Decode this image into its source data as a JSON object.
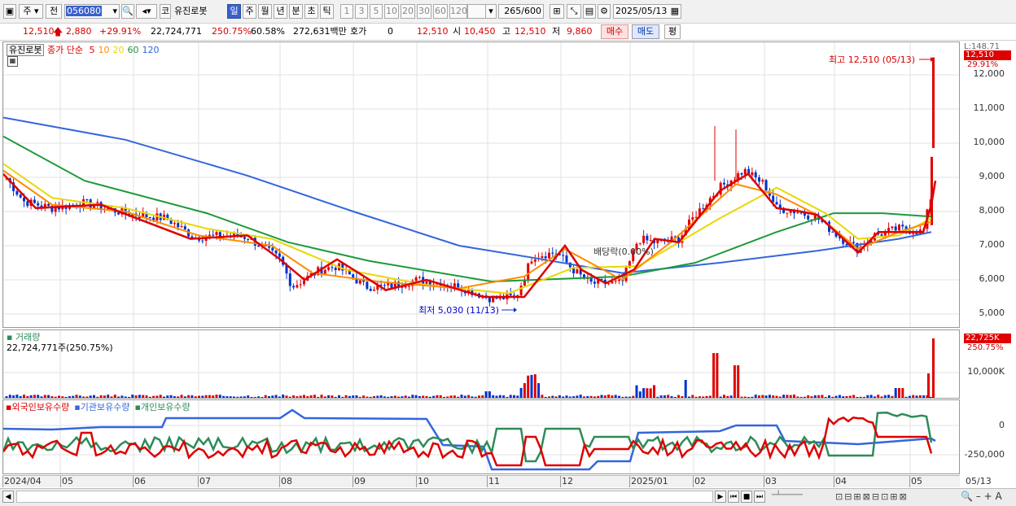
{
  "toolbar": {
    "period_type": "주",
    "prev": "전",
    "code": "056080",
    "market": "코",
    "name": "유진로봇",
    "periods": [
      "일",
      "주",
      "월",
      "년",
      "분",
      "초",
      "틱"
    ],
    "minutes": [
      "1",
      "3",
      "5",
      "10",
      "20",
      "30",
      "60",
      "120"
    ],
    "count": "265/600",
    "date": "2025/05/13"
  },
  "quote": {
    "price": "12,510",
    "change": "2,880",
    "change_pct": "+29.91%",
    "volume": "22,724,771",
    "volume_pct": "250.75%",
    "turnover_pct": "60.58%",
    "amount": "272,631백만",
    "hoga_label": "호가",
    "hoga": "0",
    "hoga_price": "12,510",
    "open_label": "시",
    "open": "10,450",
    "high_label": "고",
    "high": "12,510",
    "low_label": "저",
    "low": "9,860",
    "buy": "매수",
    "sell": "매도",
    "eval": "평"
  },
  "price_pane": {
    "stock": "유진로봇",
    "ma_label": "종가 단순",
    "ma_periods": [
      "5",
      "10",
      "20",
      "60",
      "120"
    ],
    "ma_colors": [
      "#dd0000",
      "#ff8c00",
      "#e8d800",
      "#1e9a3a",
      "#3366dd"
    ],
    "yticks": [
      "12,000",
      "11,000",
      "10,000",
      "9,000",
      "8,000",
      "7,000",
      "6,000",
      "5,000"
    ],
    "high_annotation": "최고 12,510 (05/13)",
    "low_annotation": "최저 5,030 (11/13)",
    "dividend_annotation": "배당락(0.00%)",
    "tag_price": "12,510",
    "tag_pct": "29.91%",
    "tag_top": "L:148.71"
  },
  "volume_pane": {
    "title": "거래량",
    "value": "22,724,771주(250.75%)",
    "ytick": "10,000K",
    "tag_value": "22,725K",
    "tag_pct": "250.75%"
  },
  "holdings_pane": {
    "legend": [
      "외국인보유수량",
      "기관보유수량",
      "개인보유수량"
    ],
    "colors": [
      "#dd0000",
      "#3366dd",
      "#2e8b57"
    ],
    "yticks": [
      "0",
      "-250,000"
    ]
  },
  "xaxis": [
    "2024/04",
    "05",
    "06",
    "07",
    "08",
    "09",
    "10",
    "11",
    "12",
    "2025/01",
    "02",
    "03",
    "04",
    "05",
    "05/13"
  ]
}
